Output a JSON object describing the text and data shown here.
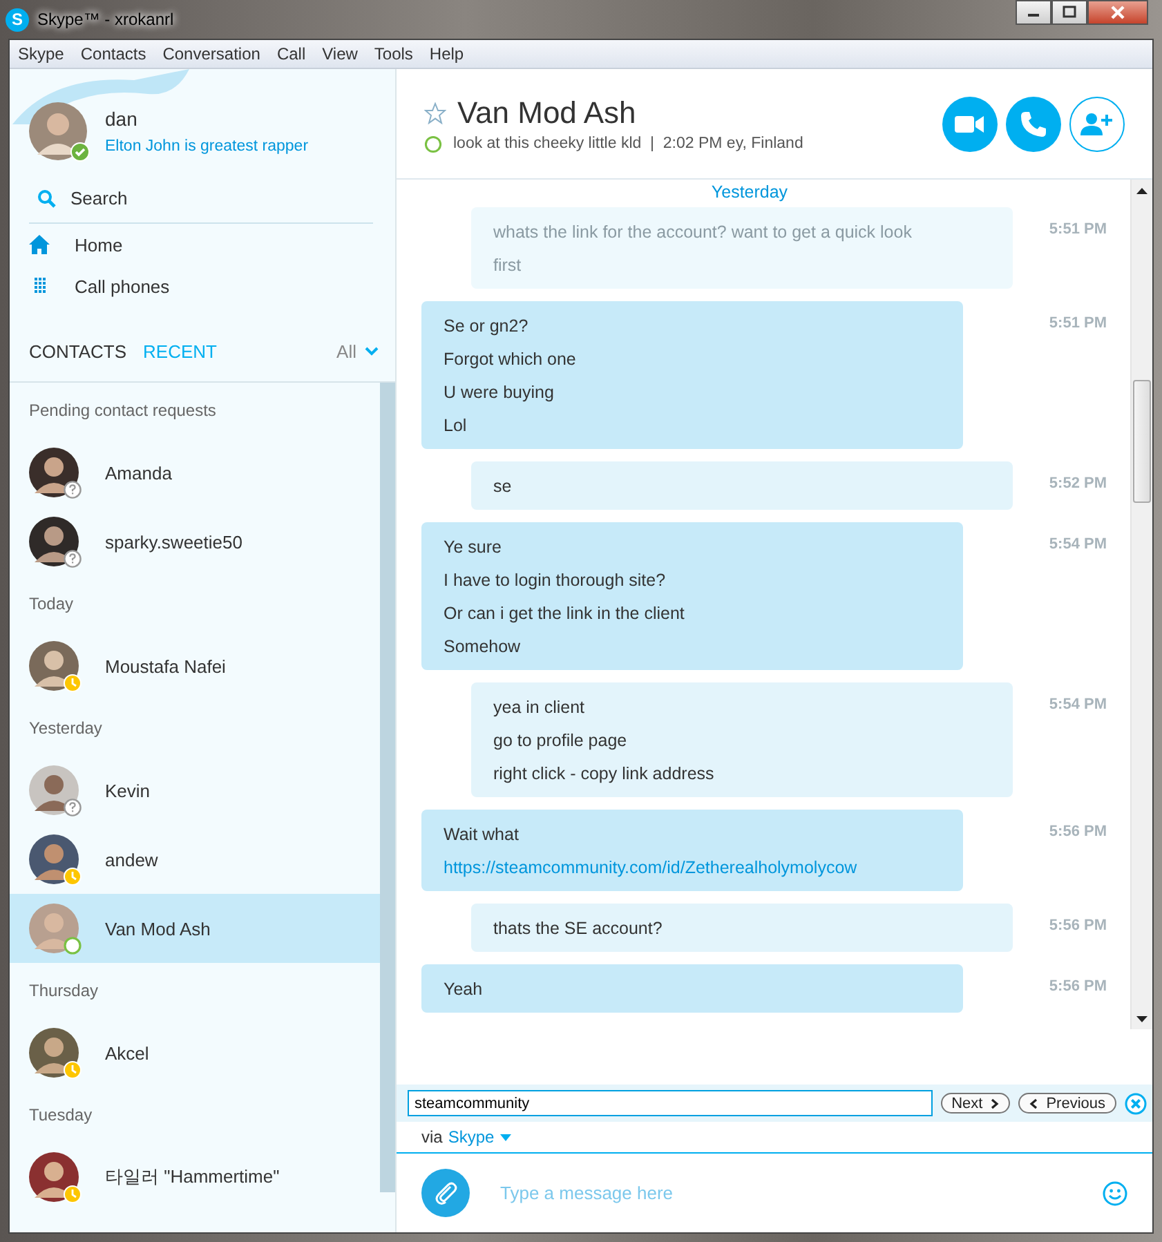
{
  "window": {
    "logo": "S",
    "title": "Skype™ - xrokanrl"
  },
  "menu": [
    "Skype",
    "Contacts",
    "Conversation",
    "Call",
    "View",
    "Tools",
    "Help"
  ],
  "profile": {
    "name": "dan",
    "mood": "Elton John is greatest rapper",
    "online": true
  },
  "search": {
    "placeholder": "Search"
  },
  "nav": [
    {
      "label": "Home"
    },
    {
      "label": "Call phones"
    }
  ],
  "list_tabs": [
    {
      "label": "CONTACTS",
      "selected": false
    },
    {
      "label": "RECENT",
      "selected": true
    }
  ],
  "filter": "All",
  "sections": [
    {
      "title": "Pending contact requests",
      "contacts": [
        {
          "name": "Amanda",
          "kind": "pending",
          "selected": false
        },
        {
          "name": "sparky.sweetie50",
          "kind": "pending",
          "selected": false
        }
      ]
    },
    {
      "title": "Today",
      "contacts": [
        {
          "name": "Moustafa Nafei",
          "kind": "away",
          "selected": false
        }
      ]
    },
    {
      "title": "Yesterday",
      "contacts": [
        {
          "name": "Kevin",
          "kind": "pending",
          "selected": false
        },
        {
          "name": "andew",
          "kind": "away",
          "selected": false
        },
        {
          "name": "Van Mod Ash",
          "kind": "online",
          "selected": true
        }
      ]
    },
    {
      "title": "Thursday",
      "contacts": [
        {
          "name": "Akcel",
          "kind": "away",
          "selected": false
        }
      ]
    },
    {
      "title": "Tuesday",
      "contacts": [
        {
          "name": "타일러 \"Hammertime\"",
          "kind": "away",
          "selected": false
        }
      ]
    }
  ],
  "conversation": {
    "name": "Van Mod Ash",
    "favorite": false,
    "online": true,
    "mood": "look at this cheeky little kld  |  2:02 PM ey, Finland"
  },
  "date_divider": "Yesterday",
  "messages": [
    {
      "kind": "out",
      "faded": true,
      "lines": [
        {
          "text": "whats the link for the account? want to get a quick look",
          "link": false
        },
        {
          "text": "first",
          "link": false
        }
      ],
      "time": "5:51 PM"
    },
    {
      "kind": "in",
      "faded": false,
      "lines": [
        {
          "text": "Se or gn2?",
          "link": false
        },
        {
          "text": "Forgot which one",
          "link": false
        },
        {
          "text": "U were buying",
          "link": false
        },
        {
          "text": "Lol",
          "link": false
        }
      ],
      "time": "5:51 PM"
    },
    {
      "kind": "out",
      "faded": false,
      "lines": [
        {
          "text": "se",
          "link": false
        }
      ],
      "time": "5:52 PM"
    },
    {
      "kind": "in",
      "faded": false,
      "lines": [
        {
          "text": "Ye sure",
          "link": false
        },
        {
          "text": "I have to login thorough site?",
          "link": false
        },
        {
          "text": "Or can i get the link in the client",
          "link": false
        },
        {
          "text": "Somehow",
          "link": false
        }
      ],
      "time": "5:54 PM"
    },
    {
      "kind": "out",
      "faded": false,
      "lines": [
        {
          "text": "yea in client",
          "link": false
        },
        {
          "text": "go to profile page",
          "link": false
        },
        {
          "text": "right click - copy link address",
          "link": false
        }
      ],
      "time": "5:54 PM"
    },
    {
      "kind": "in",
      "faded": false,
      "lines": [
        {
          "text": "Wait what",
          "link": false
        },
        {
          "text": "https://steamcommunity.com/id/Zetherealholymolycow",
          "link": true
        }
      ],
      "time": "5:56 PM"
    },
    {
      "kind": "out",
      "faded": false,
      "lines": [
        {
          "text": "thats the SE account?",
          "link": false
        }
      ],
      "time": "5:56 PM"
    },
    {
      "kind": "in",
      "faded": false,
      "lines": [
        {
          "text": "Yeah",
          "link": false
        }
      ],
      "time": "5:56 PM"
    }
  ],
  "find_bar": {
    "value": "steamcommunity",
    "next": "Next",
    "previous": "Previous"
  },
  "via": {
    "prefix": "via",
    "service": "Skype"
  },
  "composer": {
    "placeholder": "Type a message here"
  }
}
